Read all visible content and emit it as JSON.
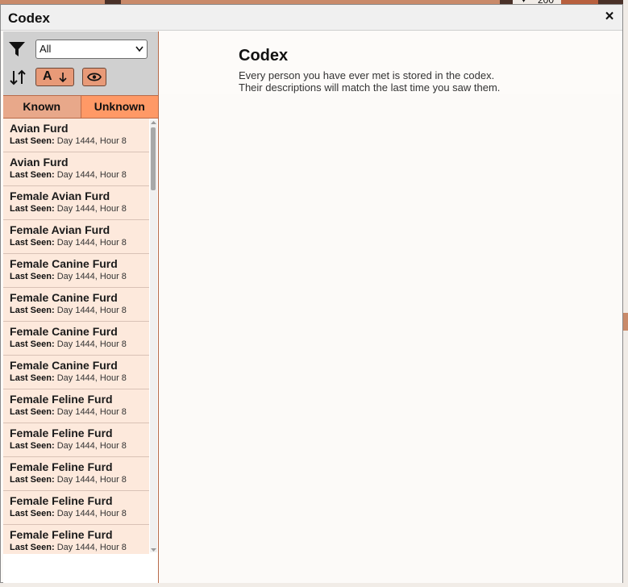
{
  "window": {
    "title": "Codex",
    "close_label": "×"
  },
  "filter": {
    "selected": "All"
  },
  "sort": {
    "label": "A"
  },
  "tabs": [
    {
      "label": "Known",
      "active": false
    },
    {
      "label": "Unknown",
      "active": true
    }
  ],
  "list": {
    "last_seen_label": "Last Seen:",
    "items": [
      {
        "name": "Avian Furd",
        "seen": "Day 1444, Hour 8"
      },
      {
        "name": "Avian Furd",
        "seen": "Day 1444, Hour 8"
      },
      {
        "name": "Female Avian Furd",
        "seen": "Day 1444, Hour 8"
      },
      {
        "name": "Female Avian Furd",
        "seen": "Day 1444, Hour 8"
      },
      {
        "name": "Female Canine Furd",
        "seen": "Day 1444, Hour 8"
      },
      {
        "name": "Female Canine Furd",
        "seen": "Day 1444, Hour 8"
      },
      {
        "name": "Female Canine Furd",
        "seen": "Day 1444, Hour 8"
      },
      {
        "name": "Female Canine Furd",
        "seen": "Day 1444, Hour 8"
      },
      {
        "name": "Female Feline Furd",
        "seen": "Day 1444, Hour 8"
      },
      {
        "name": "Female Feline Furd",
        "seen": "Day 1444, Hour 8"
      },
      {
        "name": "Female Feline Furd",
        "seen": "Day 1444, Hour 8"
      },
      {
        "name": "Female Feline Furd",
        "seen": "Day 1444, Hour 8"
      },
      {
        "name": "Female Feline Furd",
        "seen": "Day 1444, Hour 8"
      }
    ]
  },
  "main": {
    "title": "Codex",
    "desc_line1": "Every person you have ever met is stored in the codex.",
    "desc_line2": "Their descriptions will match the last time you saw them."
  },
  "background": {
    "counter": "200"
  },
  "colors": {
    "accent": "#ff9966",
    "tab_known": "#e8a88a",
    "item_bg": "#fde9dc",
    "button": "#e89a78"
  },
  "icons": [
    "filter-icon",
    "sort-icon",
    "arrow-down-icon",
    "eye-icon",
    "close-icon",
    "heart-icon"
  ]
}
